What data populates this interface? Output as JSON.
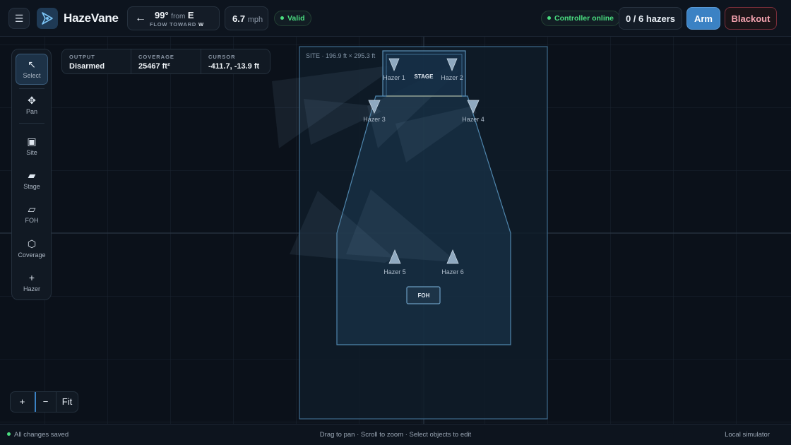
{
  "app": {
    "name": "HazeVane"
  },
  "wind": {
    "degrees": "99°",
    "from_label": "from",
    "from_dir": "E",
    "flow_label": "FLOW TOWARD",
    "flow_dir": "W",
    "speed": "6.7",
    "speed_unit": "mph"
  },
  "validation": {
    "label": "Valid"
  },
  "controller": {
    "label": "Controller online"
  },
  "hazers": {
    "count_label": "0 / 6 hazers"
  },
  "actions": {
    "arm": "Arm",
    "blackout": "Blackout"
  },
  "tools": [
    {
      "label": "Select",
      "icon": "arrow-cursor-icon",
      "active": true
    },
    {
      "label": "Pan",
      "icon": "move-icon"
    },
    {
      "label": "Site",
      "icon": "square-icon"
    },
    {
      "label": "Stage",
      "icon": "parallelogram-filled-icon"
    },
    {
      "label": "FOH",
      "icon": "parallelogram-outline-icon"
    },
    {
      "label": "Coverage",
      "icon": "hexagon-icon"
    },
    {
      "label": "Hazer",
      "icon": "plus-icon"
    }
  ],
  "info": {
    "output_label": "OUTPUT",
    "output_value": "Disarmed",
    "coverage_label": "COVERAGE",
    "coverage_value": "25467 ft²",
    "cursor_label": "CURSOR",
    "cursor_value": "-411.7, -13.9 ft"
  },
  "canvas": {
    "site_label": "SITE · 196.9 ft × 295.3 ft",
    "stage_label": "STAGE",
    "foh_label": "FOH",
    "hazer_labels": [
      "Hazer 1",
      "Hazer 2",
      "Hazer 3",
      "Hazer 4",
      "Hazer 5",
      "Hazer 6"
    ]
  },
  "zoom": {
    "in": "+",
    "out": "−",
    "fit": "Fit"
  },
  "status": {
    "saved": "All changes saved",
    "hint": "Drag to pan · Scroll to zoom · Select objects to edit",
    "mode": "Local simulator"
  },
  "colors": {
    "accent": "#3b82c4",
    "ok": "#4ade80",
    "danger": "#7a2e3a",
    "background": "#0b111a"
  }
}
